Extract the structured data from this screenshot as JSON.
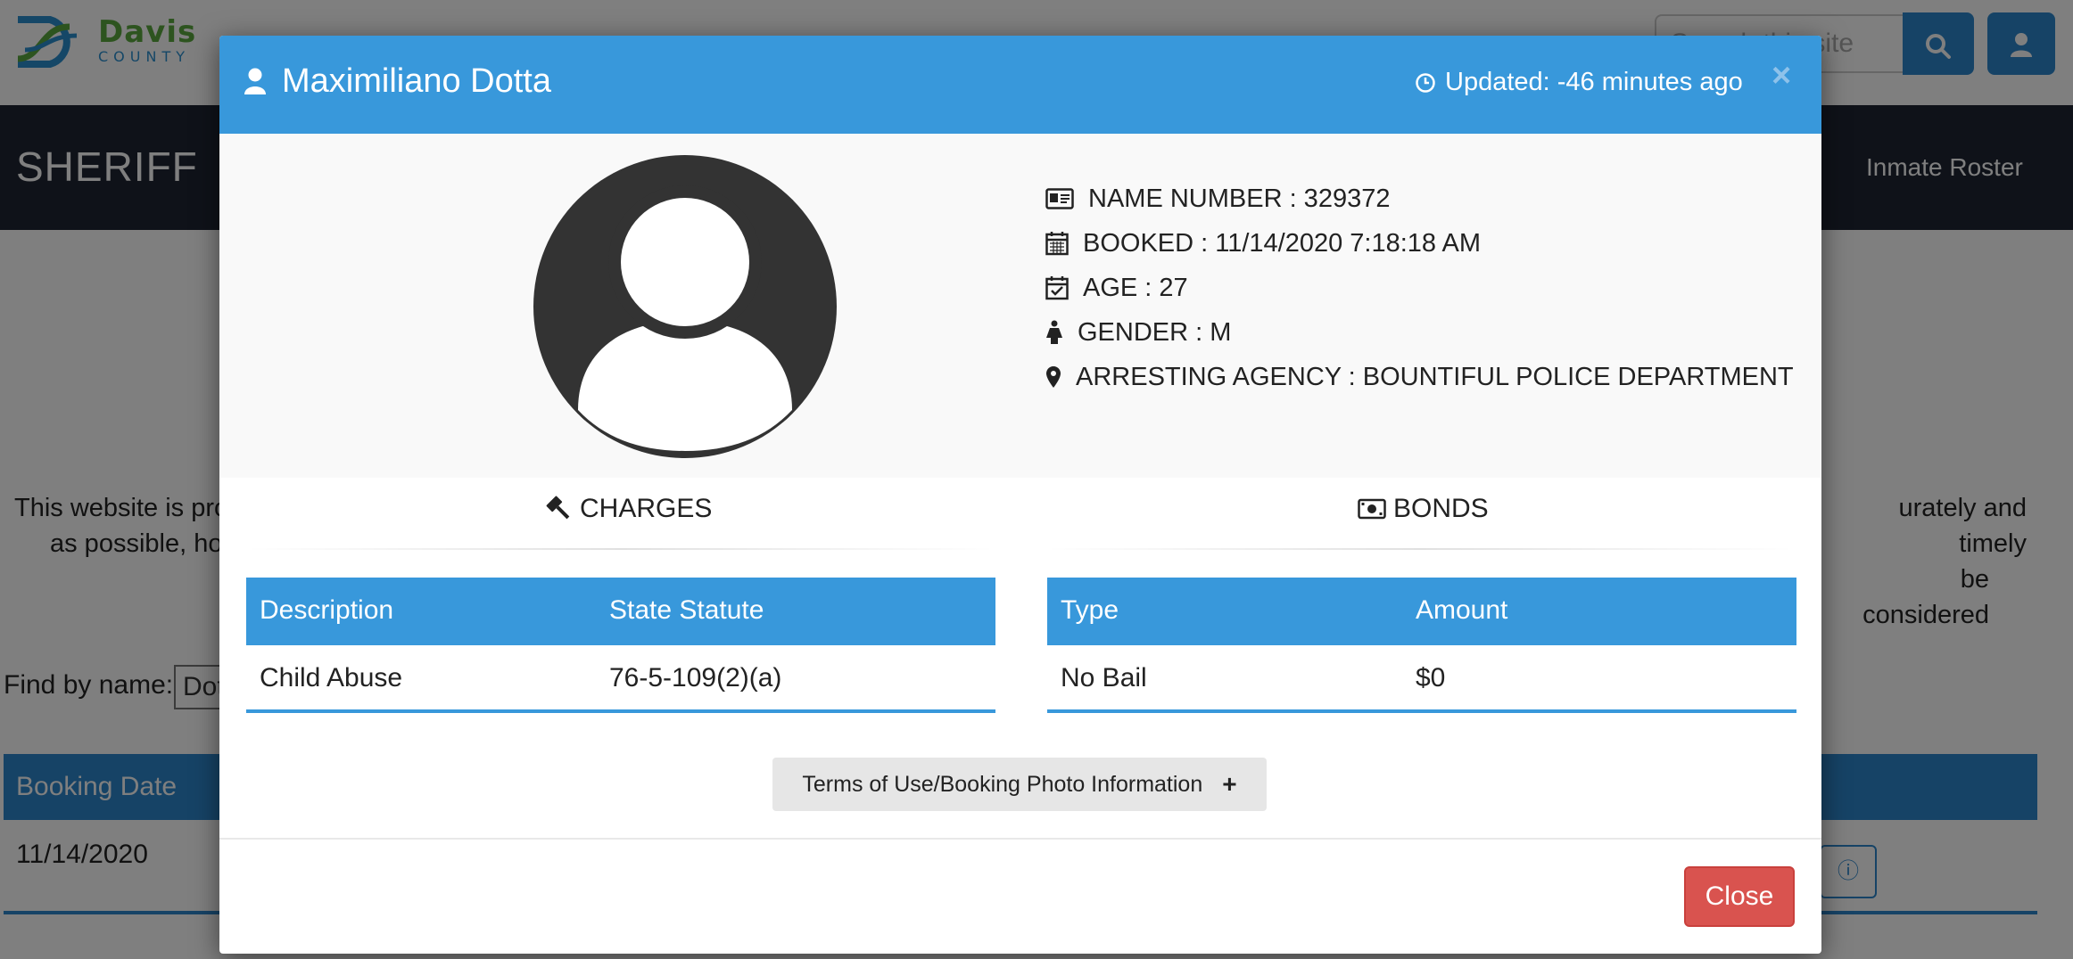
{
  "site": {
    "logo_name": "Davis",
    "logo_sub": "COUNTY",
    "search_placeholder": "Search this site",
    "sheriff_title": "SHERIFF",
    "inmate_roster_link": "Inmate Roster",
    "notice_left_1": "This website is pro",
    "notice_left_2": "as possible, ho",
    "notice_right_1": "urately and timely",
    "notice_right_2": "be considered",
    "find_label": "Find by name:",
    "find_value": "Dot",
    "roster_col_booking": "Booking Date",
    "roster_booking_value": "11/14/2020"
  },
  "modal": {
    "inmate_name": "Maximiliano Dotta",
    "updated": "Updated: -46 minutes ago",
    "close_x": "×",
    "details": {
      "name_number": "NAME NUMBER : 329372",
      "booked": "BOOKED : 11/14/2020 7:18:18 AM",
      "age": "AGE : 27",
      "gender": "GENDER : M",
      "agency": "ARRESTING AGENCY : BOUNTIFUL POLICE DEPARTMENT"
    },
    "charges": {
      "title": "CHARGES",
      "columns": [
        "Description",
        "State Statute"
      ],
      "rows": [
        [
          "Child Abuse",
          "76-5-109(2)(a)"
        ]
      ]
    },
    "bonds": {
      "title": "BONDS",
      "columns": [
        "Type",
        "Amount"
      ],
      "rows": [
        [
          "No Bail",
          "$0"
        ]
      ]
    },
    "terms_button": "Terms of Use/Booking Photo Information",
    "terms_plus": "+",
    "close_button": "Close"
  },
  "colors": {
    "modal_header": "#3898db",
    "sheriff_bar": "#1e2433",
    "close_button": "#d9534f",
    "logo_green": "#5aa83e"
  }
}
